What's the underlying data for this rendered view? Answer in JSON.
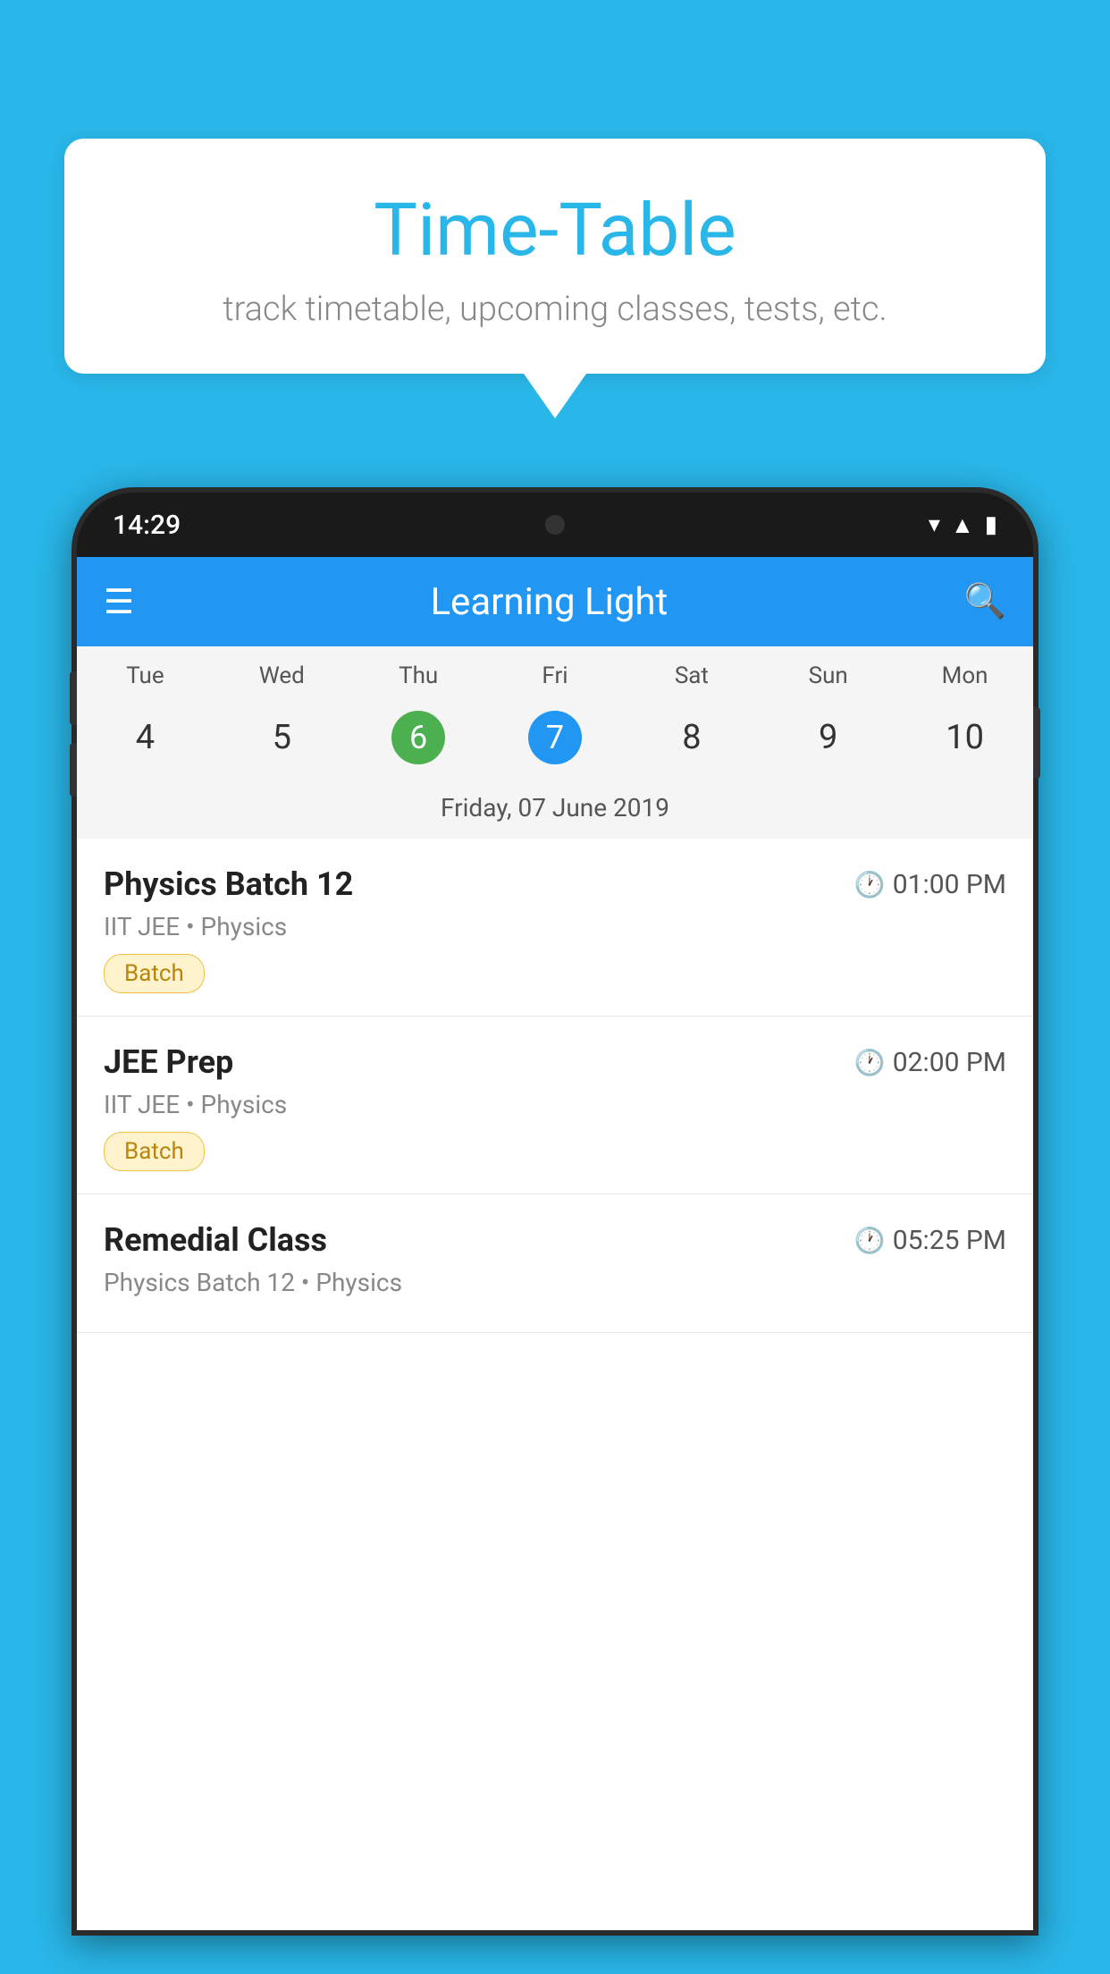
{
  "background": {
    "color": "#29b6e8"
  },
  "speech_bubble": {
    "title": "Time-Table",
    "subtitle": "track timetable, upcoming classes, tests, etc."
  },
  "phone": {
    "status_bar": {
      "time": "14:29"
    },
    "app_header": {
      "title": "Learning Light"
    },
    "calendar": {
      "days": [
        {
          "name": "Tue",
          "number": "4",
          "state": "normal"
        },
        {
          "name": "Wed",
          "number": "5",
          "state": "normal"
        },
        {
          "name": "Thu",
          "number": "6",
          "state": "today"
        },
        {
          "name": "Fri",
          "number": "7",
          "state": "selected"
        },
        {
          "name": "Sat",
          "number": "8",
          "state": "normal"
        },
        {
          "name": "Sun",
          "number": "9",
          "state": "normal"
        },
        {
          "name": "Mon",
          "number": "10",
          "state": "normal"
        }
      ],
      "selected_date_label": "Friday, 07 June 2019"
    },
    "schedule": [
      {
        "title": "Physics Batch 12",
        "time": "01:00 PM",
        "subtitle": "IIT JEE • Physics",
        "badge": "Batch"
      },
      {
        "title": "JEE Prep",
        "time": "02:00 PM",
        "subtitle": "IIT JEE • Physics",
        "badge": "Batch"
      },
      {
        "title": "Remedial Class",
        "time": "05:25 PM",
        "subtitle": "Physics Batch 12 • Physics",
        "badge": null
      }
    ]
  }
}
